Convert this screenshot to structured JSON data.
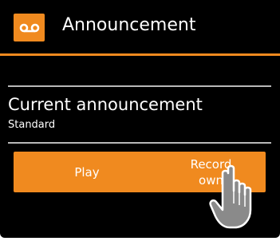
{
  "header": {
    "icon": "voicemail-icon",
    "title": "Announcement"
  },
  "announcement": {
    "label": "Current announcement",
    "value": "Standard"
  },
  "buttons": {
    "play_label": "Play",
    "record_label": "Record own"
  },
  "pointer": {
    "icon": "hand-pointer-icon"
  },
  "colors": {
    "accent": "#f08a1f",
    "background": "#000000",
    "text": "#ffffff",
    "divider": "#b8b8b8",
    "hand": "#8a8a8a"
  }
}
